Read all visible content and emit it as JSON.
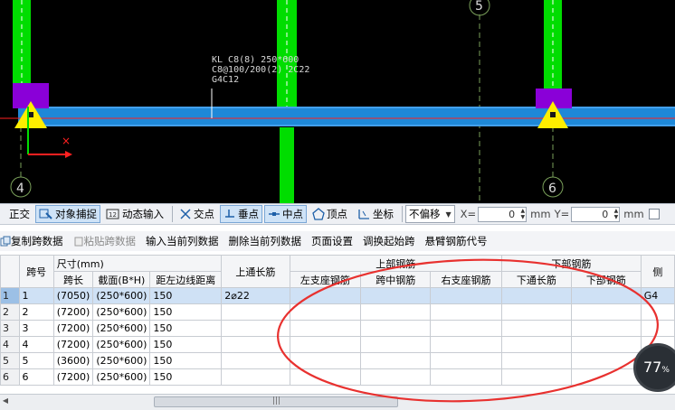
{
  "canvas": {
    "axis_labels": [
      "5",
      "4",
      "6"
    ],
    "annotation_lines": [
      "KL C8(8) 250*600",
      "C8@100/200(2) 2C22",
      "G4C12"
    ]
  },
  "snapbar": {
    "items": [
      {
        "label": "正交",
        "icon": "ortho-icon",
        "active": false
      },
      {
        "label": "对象捕捉",
        "icon": "object-snap-icon",
        "active": true
      },
      {
        "label": "动态输入",
        "icon": "dynamic-input-icon",
        "active": false
      },
      {
        "label": "交点",
        "icon": "intersection-icon",
        "active": false
      },
      {
        "label": "垂点",
        "icon": "perpendicular-icon",
        "active": true
      },
      {
        "label": "中点",
        "icon": "midpoint-icon",
        "active": true
      },
      {
        "label": "顶点",
        "icon": "vertex-icon",
        "active": false
      },
      {
        "label": "坐标",
        "icon": "coordinate-icon",
        "active": false
      }
    ],
    "offset_mode": "不偏移",
    "x_label": "X=",
    "x_value": "0",
    "y_label": "Y=",
    "y_value": "0",
    "unit": "mm"
  },
  "editbar": {
    "copy": "复制跨数据",
    "paste": "粘贴跨数据",
    "input_col": "输入当前列数据",
    "delete_col": "删除当前列数据",
    "page_setup": "页面设置",
    "swap_start": "调换起始跨",
    "cantilever": "悬臂钢筋代号"
  },
  "grid": {
    "headers": {
      "span_no": "跨号",
      "size_group": "尺寸(mm)",
      "span_len": "跨长",
      "section": "截面(B*H)",
      "dist_left": "距左边线距离",
      "top_through": "上通长筋",
      "top_group": "上部钢筋",
      "left_support": "左支座钢筋",
      "mid_span": "跨中钢筋",
      "right_support": "右支座钢筋",
      "bottom_group": "下部钢筋",
      "bottom_through": "下通长筋",
      "bottom_bar": "下部钢筋",
      "stirrup_cut": "侧"
    },
    "rows": [
      {
        "n": "1",
        "span": "1",
        "len": "(7050)",
        "sec": "(250*600)",
        "dist": "150",
        "top": "2⌀22",
        "last": "G4"
      },
      {
        "n": "2",
        "span": "2",
        "len": "(7200)",
        "sec": "(250*600)",
        "dist": "150",
        "top": "",
        "last": ""
      },
      {
        "n": "3",
        "span": "3",
        "len": "(7200)",
        "sec": "(250*600)",
        "dist": "150",
        "top": "",
        "last": ""
      },
      {
        "n": "4",
        "span": "4",
        "len": "(7200)",
        "sec": "(250*600)",
        "dist": "150",
        "top": "",
        "last": ""
      },
      {
        "n": "5",
        "span": "5",
        "len": "(3600)",
        "sec": "(250*600)",
        "dist": "150",
        "top": "",
        "last": ""
      },
      {
        "n": "6",
        "span": "6",
        "len": "(7200)",
        "sec": "(250*600)",
        "dist": "150",
        "top": "",
        "last": ""
      }
    ]
  },
  "overlay": {
    "percent": "77",
    "percent_sign": "%"
  },
  "colors": {
    "beam": "#1e88d8",
    "column": "#00dd00",
    "support": "#ffee00",
    "pad": "#8a00d8",
    "axis_red": "#ff2020",
    "highlight_circle": "#e8312f"
  }
}
